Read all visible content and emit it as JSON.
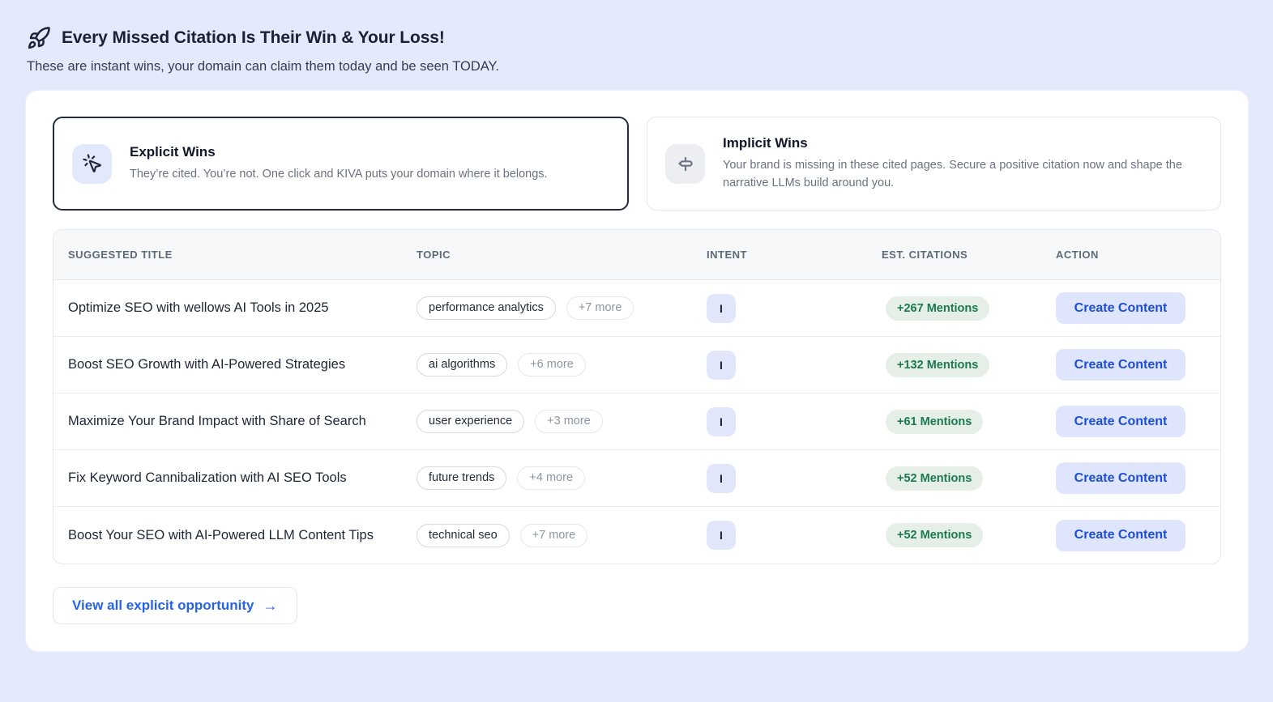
{
  "page": {
    "title": "Every Missed Citation Is Their Win & Your Loss!",
    "subtitle": "These are instant wins, your domain can claim them today and be seen TODAY."
  },
  "cards": {
    "explicit": {
      "title": "Explicit Wins",
      "description": "They’re cited. You’re not. One click and KIVA puts your domain where it belongs.",
      "icon": "cursor-click-icon",
      "selected": true
    },
    "implicit": {
      "title": "Implicit Wins",
      "description": "Your brand is missing in these cited pages. Secure a positive citation now and shape the narrative LLMs build around you.",
      "icon": "signpost-icon",
      "selected": false
    }
  },
  "table": {
    "headers": [
      "SUGGESTED TITLE",
      "TOPIC",
      "INTENT",
      "EST. CITATIONS",
      "ACTION"
    ],
    "rows": [
      {
        "title": "Optimize SEO with wellows AI Tools in 2025",
        "topic": "performance analytics",
        "more": "+7 more",
        "intent": "I",
        "citations": "+267 Mentions",
        "action": "Create Content"
      },
      {
        "title": "Boost SEO Growth with AI-Powered Strategies",
        "topic": "ai algorithms",
        "more": "+6 more",
        "intent": "I",
        "citations": "+132 Mentions",
        "action": "Create Content"
      },
      {
        "title": "Maximize Your Brand Impact with Share of Search",
        "topic": "user experience",
        "more": "+3 more",
        "intent": "I",
        "citations": "+61 Mentions",
        "action": "Create Content"
      },
      {
        "title": "Fix Keyword Cannibalization with AI SEO Tools",
        "topic": "future trends",
        "more": "+4 more",
        "intent": "I",
        "citations": "+52 Mentions",
        "action": "Create Content"
      },
      {
        "title": "Boost Your SEO with AI-Powered LLM Content Tips",
        "topic": "technical seo",
        "more": "+7 more",
        "intent": "I",
        "citations": "+52 Mentions",
        "action": "Create Content"
      }
    ]
  },
  "footer": {
    "view_all_label": "View all explicit opportunity",
    "arrow": "→"
  },
  "colors": {
    "page_background": "#e4e9fc",
    "accent_blue": "#1d4ed8",
    "button_background": "#dfe5fc",
    "mentions_green_text": "#1a7a4d",
    "mentions_green_bg": "#e5efe8",
    "selected_card_border": "#242d3f"
  }
}
